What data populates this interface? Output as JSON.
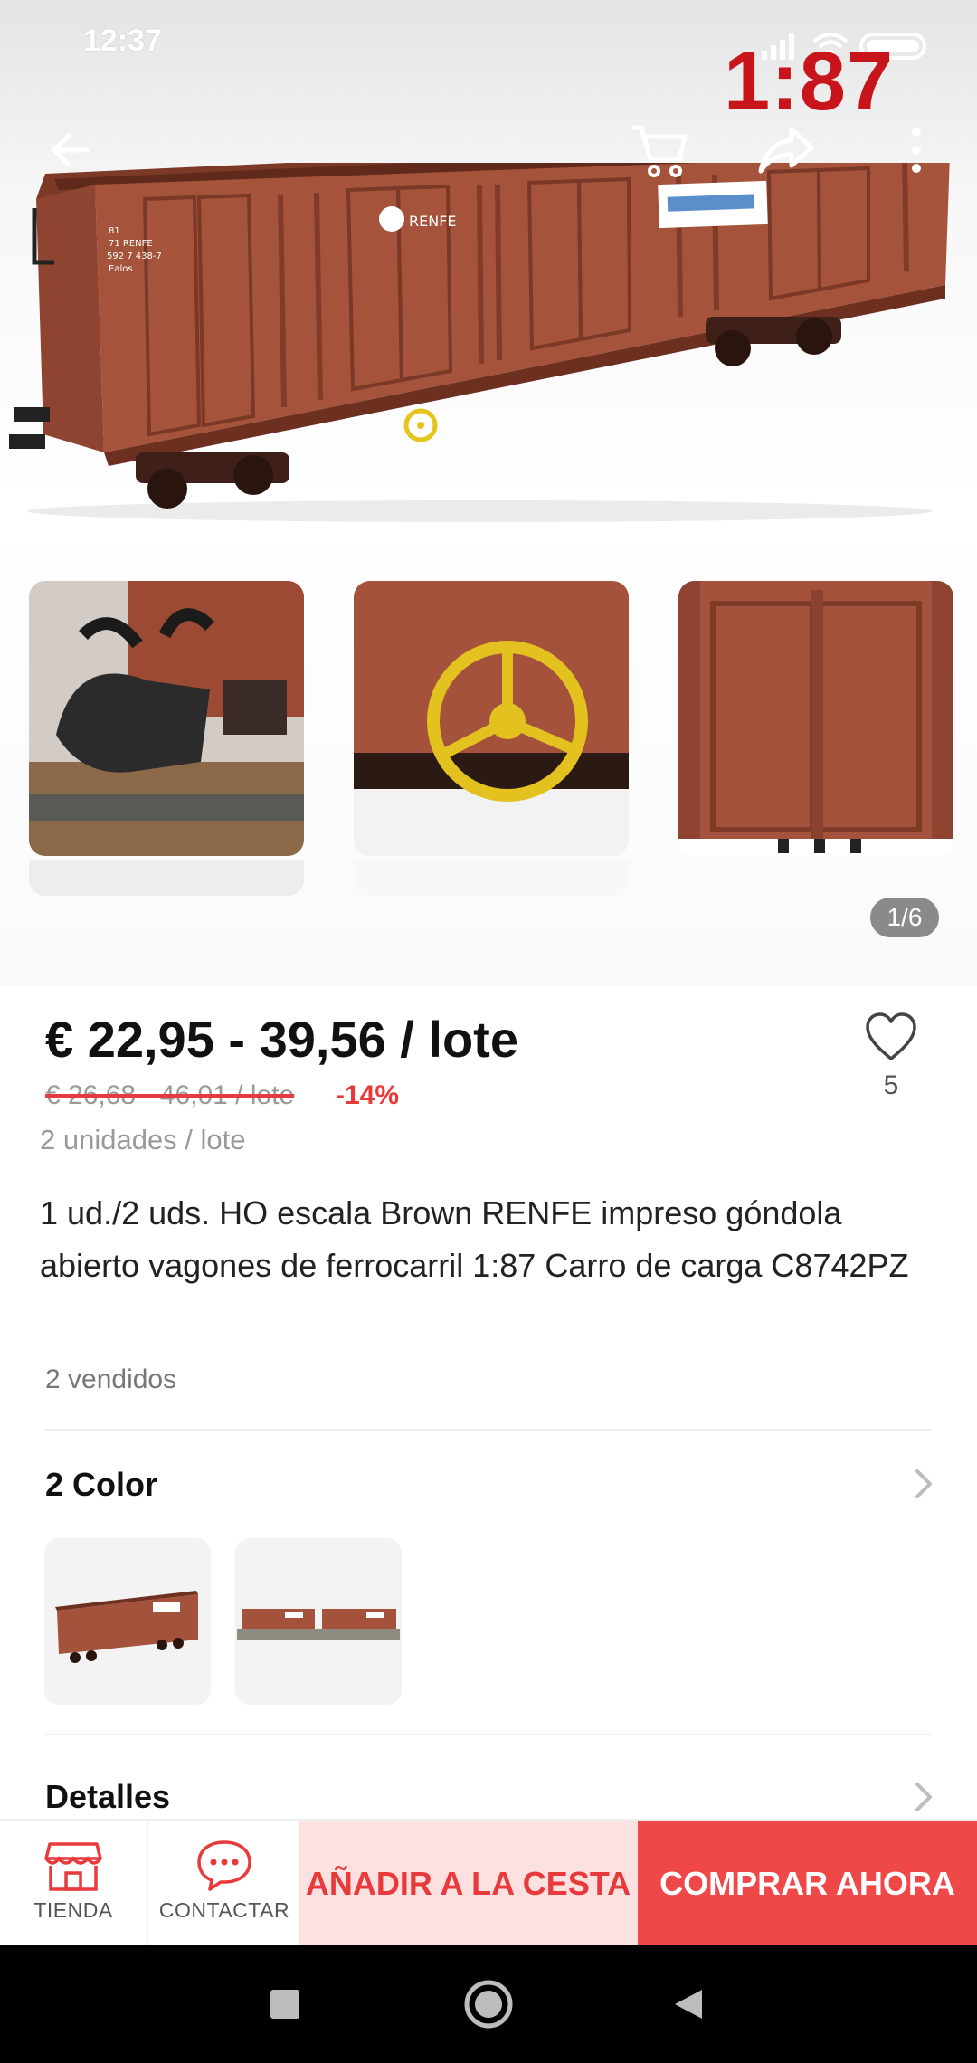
{
  "status_bar": {
    "time": "12:37",
    "icons": [
      "signal-icon",
      "wifi-icon",
      "battery-icon"
    ]
  },
  "hero": {
    "scale_badge": "1:87",
    "image": "brown-renfe-gondola-wagon",
    "thumbnails": [
      "coupler-closeup",
      "yellow-brake-wheel",
      "side-doors-closeup"
    ],
    "pager": "1/6"
  },
  "top_nav": {
    "back_icon": "back-arrow-icon",
    "cart_icon": "cart-icon",
    "share_icon": "share-icon",
    "more_icon": "more-vertical-icon"
  },
  "product": {
    "price": "€ 22,95 - 39,56 / lote",
    "old_price": "€ 26,68 - 46,01 / lote",
    "discount": "-14%",
    "units": "2 unidades / lote",
    "wishlist_count": "5",
    "title": "1 ud./2 uds. HO escala Brown RENFE impreso góndola abierto vagones de ferrocarril 1:87 Carro de carga C8742PZ",
    "sold": "2 vendidos"
  },
  "color_section": {
    "title": "2 Color",
    "options": [
      "single-wagon",
      "two-wagons-on-track"
    ]
  },
  "details_section": {
    "title": "Detalles"
  },
  "action_bar": {
    "store_label": "TIENDA",
    "contact_label": "CONTACTAR",
    "add_to_cart": "AÑADIR A LA CESTA",
    "buy_now": "COMPRAR AHORA"
  },
  "colors": {
    "accent": "#f04748",
    "accent_light": "#fde1e0",
    "wagon_brown": "#9a4a33",
    "badge_red": "#c8141b"
  }
}
